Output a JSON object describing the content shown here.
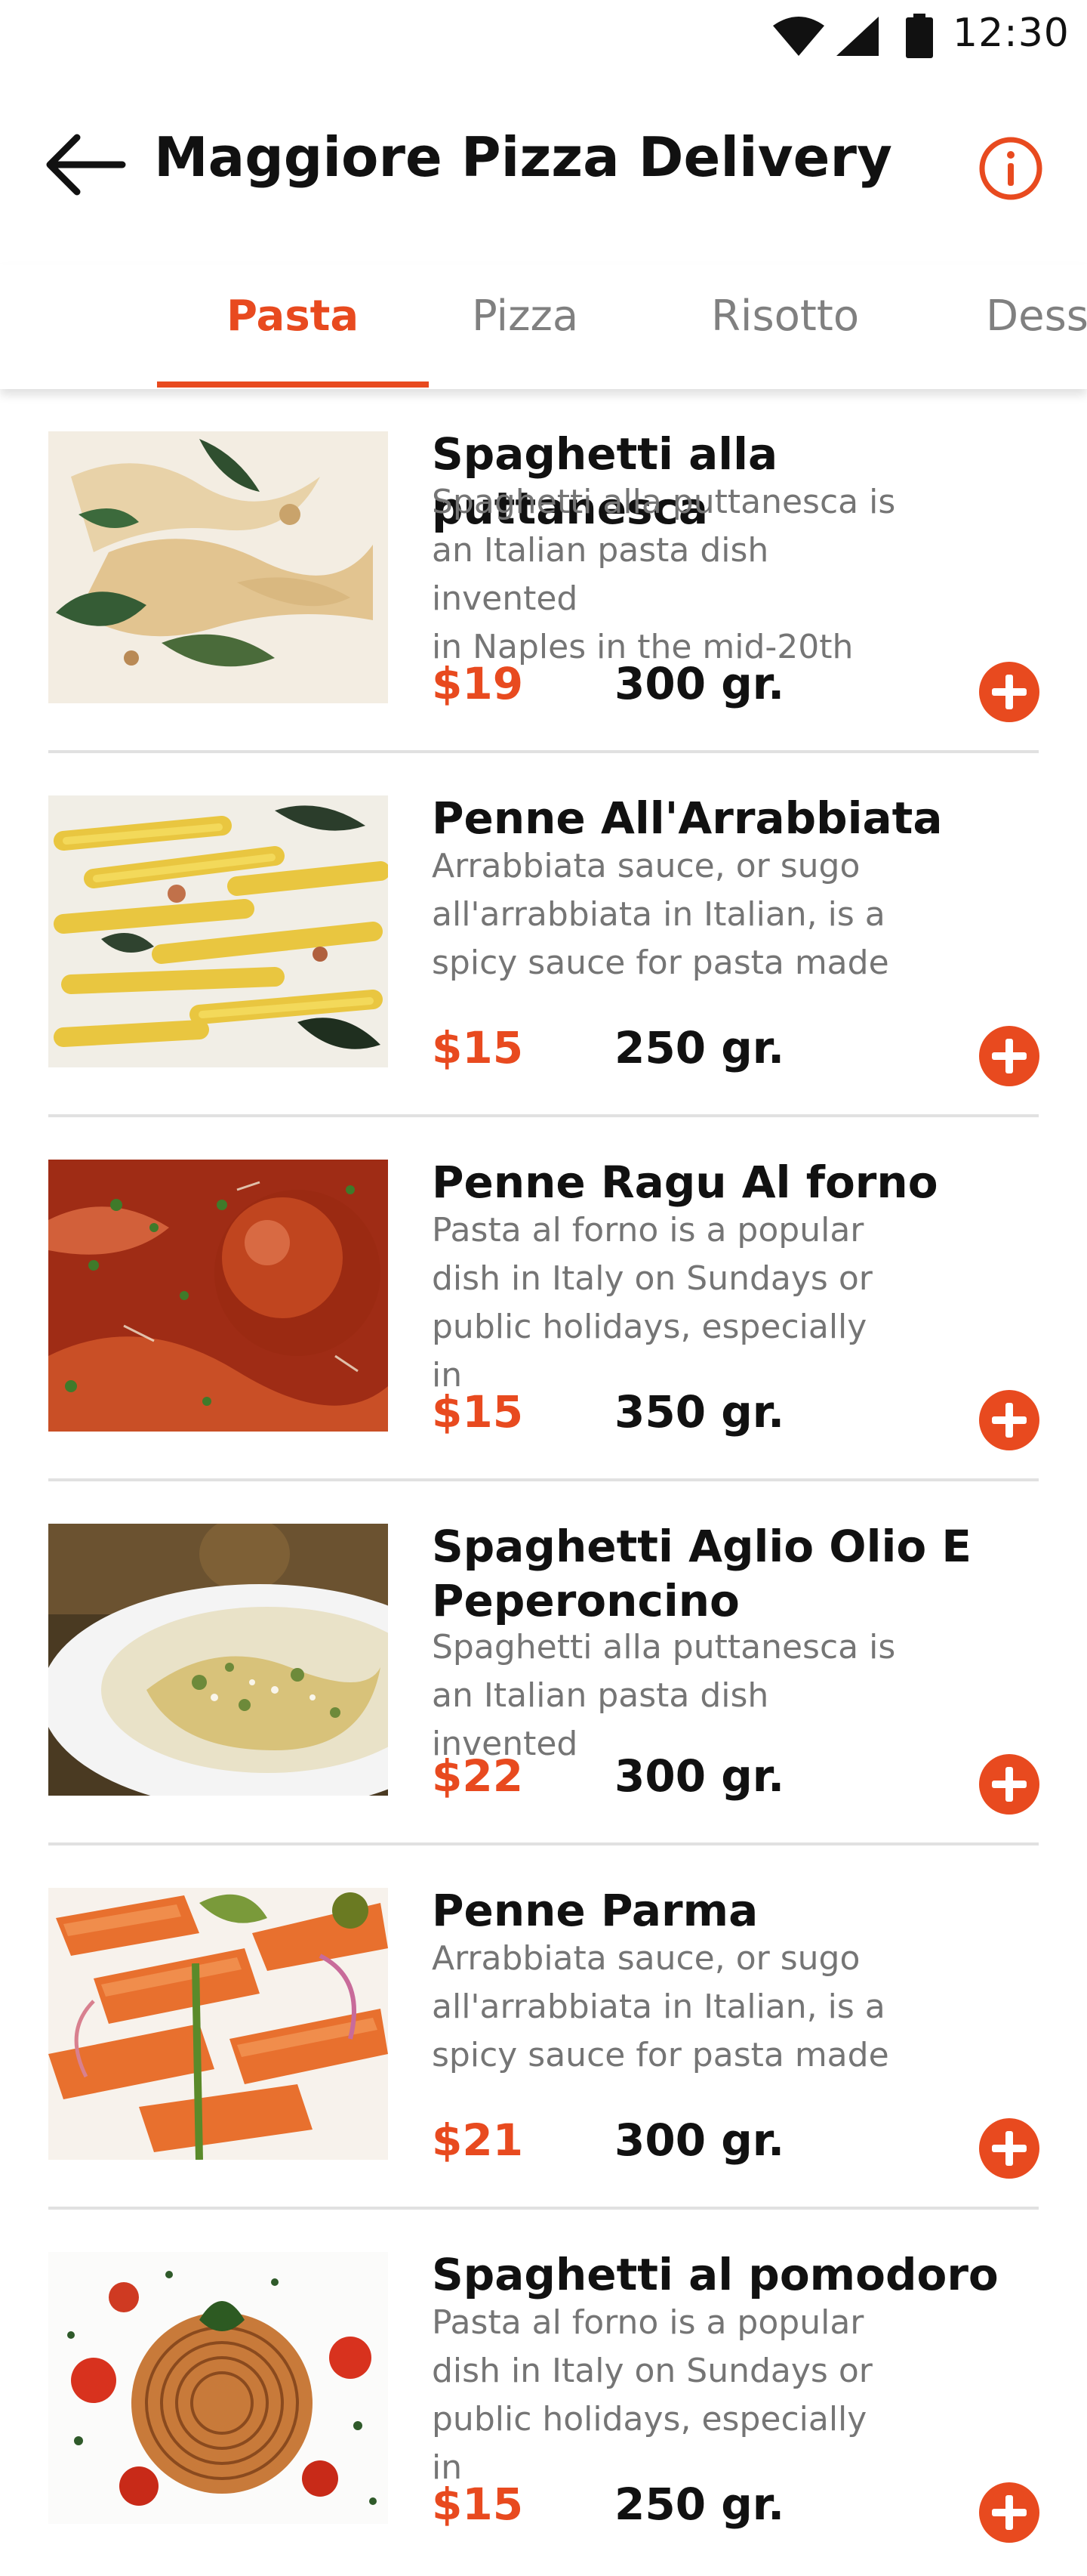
{
  "status_bar": {
    "time": "12:30",
    "icons": [
      "wifi-icon",
      "signal-icon",
      "battery-icon"
    ]
  },
  "header": {
    "title": "Maggiore Pizza Delivery",
    "back_icon": "arrow-left-icon",
    "info_icon": "info-circle-icon"
  },
  "tabs": [
    {
      "label": "Pasta",
      "active": true
    },
    {
      "label": "Pizza",
      "active": false
    },
    {
      "label": "Risotto",
      "active": false
    },
    {
      "label": "Dess",
      "active": false
    }
  ],
  "items": [
    {
      "name": "Spaghetti alla puttanesca",
      "description": [
        "Spaghetti alla puttanesca is",
        "an Italian pasta dish invented",
        "in Naples in the mid-20th"
      ],
      "price": "$19",
      "weight": "300 gr."
    },
    {
      "name": "Penne All'Arrabbiata",
      "description": [
        "Arrabbiata sauce, or sugo",
        "all'arrabbiata in Italian, is a",
        "spicy sauce for pasta made"
      ],
      "price": "$15",
      "weight": "250 gr."
    },
    {
      "name": "Penne Ragu Al forno",
      "description": [
        "Pasta al forno is a popular",
        "dish in Italy on Sundays or",
        "public holidays, especially in"
      ],
      "price": "$15",
      "weight": "350 gr."
    },
    {
      "name": "Spaghetti Aglio Olio E Peperoncino",
      "description": [
        "Spaghetti alla puttanesca is",
        "an Italian pasta dish invented"
      ],
      "price": "$22",
      "weight": "300 gr."
    },
    {
      "name": "Penne Parma",
      "description": [
        "Arrabbiata sauce, or sugo",
        "all'arrabbiata in Italian, is a",
        "spicy sauce for pasta made"
      ],
      "price": "$21",
      "weight": "300 gr."
    },
    {
      "name": "Spaghetti al pomodoro",
      "description": [
        "Pasta al forno is a popular",
        "dish in Italy on Sundays or",
        "public holidays, especially in"
      ],
      "price": "$15",
      "weight": "250 gr."
    }
  ],
  "colors": {
    "accent": "#e84a1f",
    "text": "#111111",
    "muted": "#757575",
    "divider": "#e1e1e1"
  }
}
